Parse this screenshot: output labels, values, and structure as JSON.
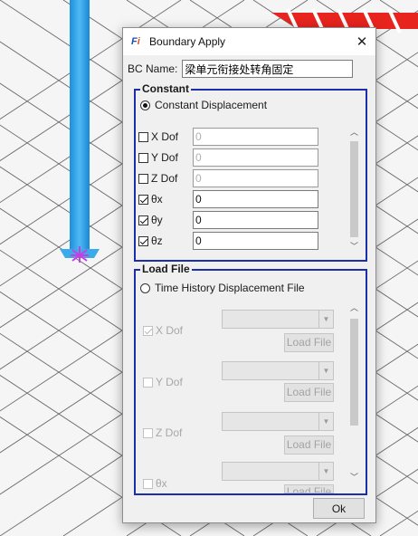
{
  "dialog": {
    "title": "Boundary Apply",
    "close_label": "✕",
    "bc_name_label": "BC Name:",
    "bc_name_value": "梁单元衔接处转角固定",
    "ok_label": "Ok"
  },
  "constant": {
    "group_title": "Constant",
    "option_label": "Constant Displacement",
    "option_selected": true,
    "rows": [
      {
        "label": "X Dof",
        "checked": false,
        "value": "0",
        "enabled": false
      },
      {
        "label": "Y Dof",
        "checked": false,
        "value": "0",
        "enabled": false
      },
      {
        "label": "Z Dof",
        "checked": false,
        "value": "0",
        "enabled": false
      },
      {
        "label": "θx",
        "checked": true,
        "value": "0",
        "enabled": true
      },
      {
        "label": "θy",
        "checked": true,
        "value": "0",
        "enabled": true
      },
      {
        "label": "θz",
        "checked": true,
        "value": "0",
        "enabled": true
      }
    ]
  },
  "load_file": {
    "group_title": "Load File",
    "option_label": "Time History Displacement File",
    "option_selected": false,
    "button_label": "Load File",
    "rows": [
      {
        "label": "X Dof",
        "checked": true
      },
      {
        "label": "Y Dof",
        "checked": false
      },
      {
        "label": "Z Dof",
        "checked": false
      },
      {
        "label": "θx",
        "checked": false
      }
    ]
  },
  "icons": {
    "app": "app-logo-icon",
    "close": "close-icon",
    "scroll_up": "chevron-up-icon",
    "scroll_down": "chevron-down-icon",
    "combo_arrow": "triangle-down-icon"
  },
  "colors": {
    "group_border": "#1c2fa8",
    "column": "#2ea3ea",
    "marker": "#c93de0",
    "stripe": "#e8241e",
    "dialog_bg": "#f0f0f0"
  }
}
